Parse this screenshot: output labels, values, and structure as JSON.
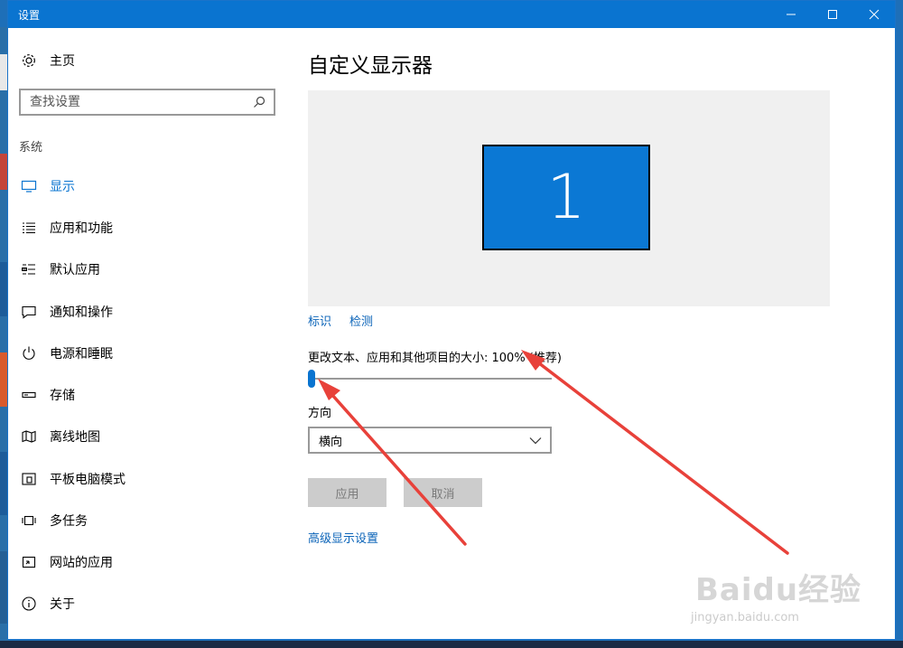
{
  "window": {
    "title": "设置",
    "controls": {
      "minimize_icon": "minimize-icon",
      "maximize_icon": "maximize-icon",
      "close_icon": "close-icon"
    }
  },
  "sidebar": {
    "home_label": "主页",
    "search_placeholder": "查找设置",
    "section_label": "系统",
    "items": [
      {
        "label": "显示",
        "icon": "monitor-icon",
        "active": true
      },
      {
        "label": "应用和功能",
        "icon": "list-icon",
        "active": false
      },
      {
        "label": "默认应用",
        "icon": "default-apps-icon",
        "active": false
      },
      {
        "label": "通知和操作",
        "icon": "notification-icon",
        "active": false
      },
      {
        "label": "电源和睡眠",
        "icon": "power-icon",
        "active": false
      },
      {
        "label": "存储",
        "icon": "storage-icon",
        "active": false
      },
      {
        "label": "离线地图",
        "icon": "map-icon",
        "active": false
      },
      {
        "label": "平板电脑模式",
        "icon": "tablet-icon",
        "active": false
      },
      {
        "label": "多任务",
        "icon": "multitask-icon",
        "active": false
      },
      {
        "label": "网站的应用",
        "icon": "web-apps-icon",
        "active": false
      },
      {
        "label": "关于",
        "icon": "info-icon",
        "active": false
      }
    ]
  },
  "main": {
    "title": "自定义显示器",
    "monitor_number": "1",
    "identify_link": "标识",
    "detect_link": "检测",
    "scale_label": "更改文本、应用和其他项目的大小: 100% (推荐)",
    "scale_slider_fraction": 0.0,
    "orientation_label": "方向",
    "orientation_value": "横向",
    "apply_button": "应用",
    "cancel_button": "取消",
    "advanced_link": "高级显示设置"
  },
  "annotations": {
    "arrow_color": "#e8413a"
  },
  "watermark": {
    "main": "Baidu经验",
    "sub": "jingyan.baidu.com"
  },
  "colors": {
    "accent": "#0a74d0",
    "titlebar": "#0a74d0",
    "link": "#0a63b8"
  }
}
